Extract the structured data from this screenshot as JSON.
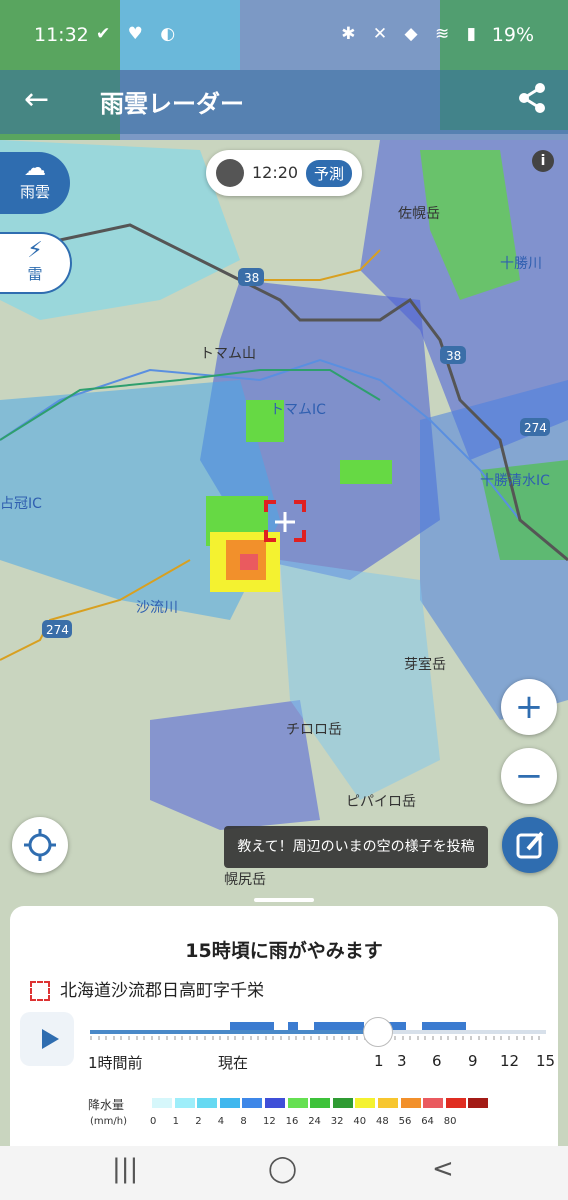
{
  "status": {
    "time": "11:32",
    "left_icons": "✔ ♥ ◐",
    "right_icons": "✱ ✕ ◆ ≋ ▮",
    "battery": "19%"
  },
  "header": {
    "back_icon": "arrow-left-icon",
    "title": "雨雲レーダー",
    "share_icon": "share-icon"
  },
  "layers": {
    "rain_label": "雨雲",
    "thunder_label": "雷"
  },
  "time_badge": {
    "time": "12:20",
    "mode": "予測"
  },
  "info_icon": "i",
  "map_labels": [
    {
      "text": "佐幌岳"
    },
    {
      "text": "十勝川"
    },
    {
      "text": "トマム山"
    },
    {
      "text": "トマムIC"
    },
    {
      "text": "十勝清水IC"
    },
    {
      "text": "占冠IC"
    },
    {
      "text": "沙流川"
    },
    {
      "text": "芽室岳"
    },
    {
      "text": "チロロ岳"
    },
    {
      "text": "ピパイロ岳"
    },
    {
      "text": "幌尻岳"
    },
    {
      "text": "38"
    },
    {
      "text": "38"
    },
    {
      "text": "274"
    },
    {
      "text": "274"
    }
  ],
  "zoom": {
    "in": "+",
    "out": "−"
  },
  "tooltip": "教えて！周辺のいまの空の様子を投稿",
  "sheet": {
    "headline": "15時頃に雨がやみます",
    "location": "北海道沙流郡日高町字千栄",
    "timeline": {
      "start": "1時間前",
      "now": "現在",
      "marks": [
        "1",
        "3",
        "6",
        "9",
        "12",
        "15"
      ],
      "position": 0.63
    },
    "legend": {
      "title": "降水量",
      "unit": "(mm/h)",
      "values": [
        "0",
        "1",
        "2",
        "4",
        "8",
        "12",
        "16",
        "24",
        "32",
        "40",
        "48",
        "56",
        "64",
        "80"
      ],
      "colors": [
        "#d6f7fb",
        "#9eeefa",
        "#66d9f2",
        "#40b7ee",
        "#3e87e8",
        "#3f4fd8",
        "#66e052",
        "#3ec23a",
        "#2f9b33",
        "#f4f230",
        "#f7c62f",
        "#f2902b",
        "#ea5a5f",
        "#e02d21",
        "#a31b16"
      ]
    }
  },
  "navbar": {
    "recents": "|||",
    "home": "◯",
    "back": "<"
  }
}
